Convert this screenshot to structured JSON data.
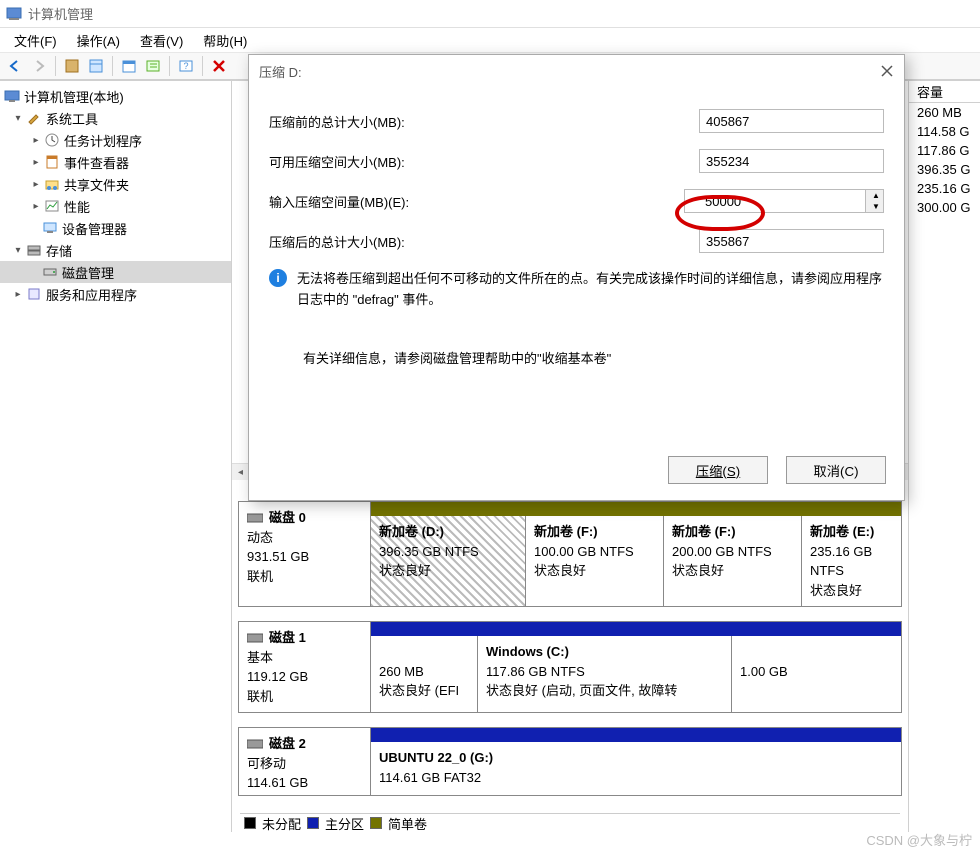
{
  "window": {
    "title": "计算机管理"
  },
  "menu": {
    "file": "文件(F)",
    "action": "操作(A)",
    "view": "查看(V)",
    "help": "帮助(H)"
  },
  "tree": {
    "root": "计算机管理(本地)",
    "system_tools": "系统工具",
    "task_scheduler": "任务计划程序",
    "event_viewer": "事件查看器",
    "shared_folders": "共享文件夹",
    "performance": "性能",
    "device_manager": "设备管理器",
    "storage": "存储",
    "disk_management": "磁盘管理",
    "services": "服务和应用程序"
  },
  "right_panel": {
    "header": "容量",
    "rows": [
      "260 MB",
      "114.58 G",
      "117.86 G",
      "396.35 G",
      "235.16 G",
      "300.00 G"
    ]
  },
  "dialog": {
    "title": "压缩 D:",
    "label_before": "压缩前的总计大小(MB):",
    "label_avail": "可用压缩空间大小(MB):",
    "label_input": "输入压缩空间量(MB)(E):",
    "label_after": "压缩后的总计大小(MB):",
    "val_before": "405867",
    "val_avail": "355234",
    "val_input": "50000",
    "val_after": "355867",
    "info1": "无法将卷压缩到超出任何不可移动的文件所在的点。有关完成该操作时间的详细信息，请参阅应用程序日志中的 \"defrag\" 事件。",
    "info2": "有关详细信息，请参阅磁盘管理帮助中的\"收缩基本卷\"",
    "btn_shrink": "压缩(S)",
    "btn_cancel": "取消(C)"
  },
  "disks": {
    "d0": {
      "name": "磁盘 0",
      "type": "动态",
      "size": "931.51 GB",
      "status": "联机",
      "v1": {
        "t": "新加卷  (D:)",
        "s": "396.35 GB NTFS",
        "st": "状态良好"
      },
      "v2": {
        "t": "新加卷  (F:)",
        "s": "100.00 GB NTFS",
        "st": "状态良好"
      },
      "v3": {
        "t": "新加卷  (F:)",
        "s": "200.00 GB NTFS",
        "st": "状态良好"
      },
      "v4": {
        "t": "新加卷  (E:)",
        "s": "235.16 GB NTFS",
        "st": "状态良好"
      }
    },
    "d1": {
      "name": "磁盘 1",
      "type": "基本",
      "size": "119.12 GB",
      "status": "联机",
      "v1": {
        "t": "",
        "s": "260 MB",
        "st": "状态良好 (EFI"
      },
      "v2": {
        "t": "Windows  (C:)",
        "s": "117.86 GB NTFS",
        "st": "状态良好 (启动, 页面文件, 故障转"
      },
      "v3": {
        "t": "",
        "s": "1.00 GB",
        "st": ""
      }
    },
    "d2": {
      "name": "磁盘 2",
      "type": "可移动",
      "size": "114.61 GB",
      "v1": {
        "t": "UBUNTU 22_0  (G:)",
        "s": "114.61 GB FAT32"
      }
    }
  },
  "legend": {
    "unalloc": "未分配",
    "primary": "主分区",
    "simple": "简单卷"
  },
  "watermark": "CSDN @大象与柠"
}
